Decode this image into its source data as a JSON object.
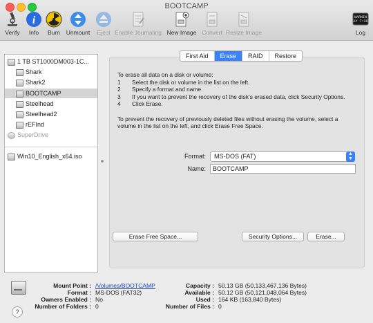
{
  "window": {
    "title": "BOOTCAMP"
  },
  "toolbar": {
    "verify": "Verify",
    "info": "Info",
    "burn": "Burn",
    "unmount": "Unmount",
    "eject": "Eject",
    "enable_journaling": "Enable Journaling",
    "new_image": "New Image",
    "convert": "Convert",
    "resize_image": "Resize Image",
    "log": "Log",
    "log_icon_text": "WARNIN\nAY 7:36"
  },
  "sidebar": {
    "items": [
      {
        "label": "1 TB ST1000DM003-1C...",
        "level": 0,
        "selected": false,
        "dim": false
      },
      {
        "label": "Shark",
        "level": 1,
        "selected": false,
        "dim": false
      },
      {
        "label": "Shark2",
        "level": 1,
        "selected": false,
        "dim": false
      },
      {
        "label": "BOOTCAMP",
        "level": 1,
        "selected": true,
        "dim": false
      },
      {
        "label": "Steelhead",
        "level": 1,
        "selected": false,
        "dim": false
      },
      {
        "label": "Steelhead2",
        "level": 1,
        "selected": false,
        "dim": false
      },
      {
        "label": "rEFInd",
        "level": 1,
        "selected": false,
        "dim": false
      },
      {
        "label": "SuperDrive",
        "level": 0,
        "selected": false,
        "dim": true
      }
    ],
    "images": [
      {
        "label": "Win10_English_x64.iso"
      }
    ]
  },
  "tabs": [
    {
      "label": "First Aid",
      "active": false
    },
    {
      "label": "Erase",
      "active": true
    },
    {
      "label": "RAID",
      "active": false
    },
    {
      "label": "Restore",
      "active": false
    }
  ],
  "erase": {
    "intro": "To erase all data on a disk or volume:",
    "steps": [
      {
        "num": "1",
        "text": "Select the disk or volume in the list on the left."
      },
      {
        "num": "2",
        "text": "Specify a format and name."
      },
      {
        "num": "3",
        "text": "If you want to prevent the recovery of the disk’s erased data, click Security Options."
      },
      {
        "num": "4",
        "text": "Click Erase."
      }
    ],
    "free_space_note": "To prevent the recovery of previously deleted files without erasing the volume, select a volume in the list on the left, and click Erase Free Space.",
    "format_label": "Format:",
    "format_value": "MS-DOS (FAT)",
    "name_label": "Name:",
    "name_value": "BOOTCAMP",
    "erase_free_space_button": "Erase Free Space...",
    "security_options_button": "Security Options...",
    "erase_button": "Erase..."
  },
  "info": {
    "mount_point_label": "Mount Point :",
    "mount_point_value": "/Volumes/BOOTCAMP",
    "format_label": "Format :",
    "format_value": "MS-DOS (FAT32)",
    "owners_enabled_label": "Owners Enabled :",
    "owners_enabled_value": "No",
    "num_folders_label": "Number of Folders :",
    "num_folders_value": "0",
    "capacity_label": "Capacity :",
    "capacity_value": "50.13 GB (50,133,467,136 Bytes)",
    "available_label": "Available :",
    "available_value": "50.12 GB (50,121,048,064 Bytes)",
    "used_label": "Used :",
    "used_value": "164 KB (163,840 Bytes)",
    "num_files_label": "Number of Files :",
    "num_files_value": "0"
  },
  "help": {
    "label": "?"
  }
}
